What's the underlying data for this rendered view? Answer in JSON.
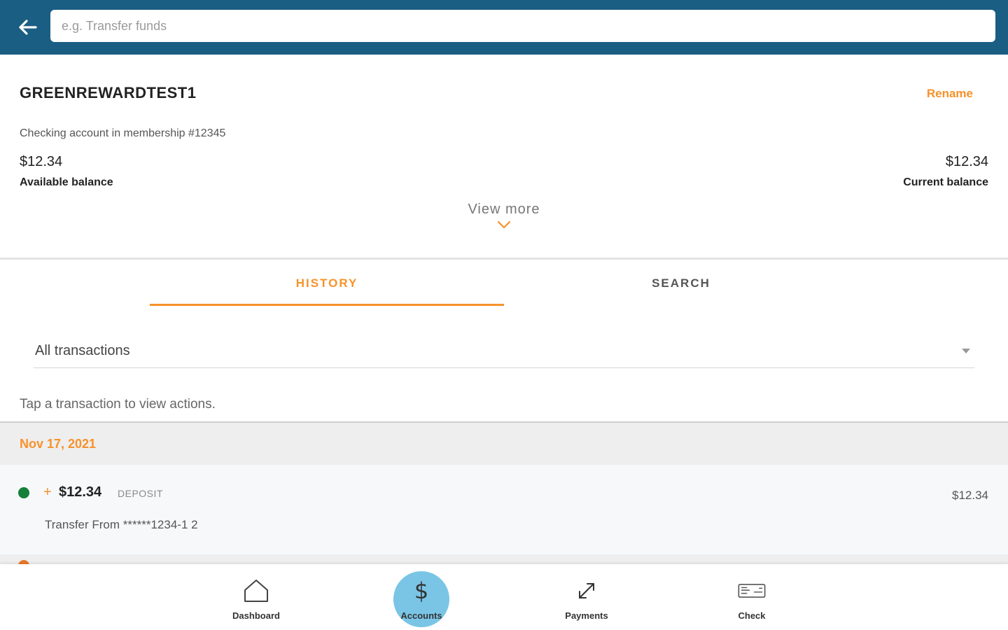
{
  "header": {
    "search_placeholder": "e.g. Transfer funds"
  },
  "account": {
    "name": "GREENREWARDTEST1",
    "rename_label": "Rename",
    "description": "Checking account in membership #12345",
    "available_amount": "$12.34",
    "available_label": "Available balance",
    "current_amount": "$12.34",
    "current_label": "Current balance",
    "view_more_label": "View more"
  },
  "tabs": [
    {
      "label": "HISTORY",
      "active": true
    },
    {
      "label": "SEARCH",
      "active": false
    }
  ],
  "filter": {
    "selected": "All transactions"
  },
  "hint": "Tap a transaction to view actions.",
  "transactions": {
    "groups": [
      {
        "date": "Nov 17, 2021",
        "items": [
          {
            "sign": "+",
            "amount": "$12.34",
            "type": "DEPOSIT",
            "description": "Transfer From ******1234-1 2",
            "balance": "$12.34",
            "status_color": "#16803a"
          }
        ]
      }
    ]
  },
  "bottom_nav": [
    {
      "label": "Dashboard",
      "icon": "home-icon"
    },
    {
      "label": "Accounts",
      "icon": "dollar-icon",
      "active": true
    },
    {
      "label": "Payments",
      "icon": "transfer-arrows-icon"
    },
    {
      "label": "Check",
      "icon": "check-icon"
    }
  ],
  "colors": {
    "header_bg": "#1b5e84",
    "accent": "#f7922a",
    "active_nav": "#6bbfe3",
    "deposit_dot": "#16803a"
  }
}
